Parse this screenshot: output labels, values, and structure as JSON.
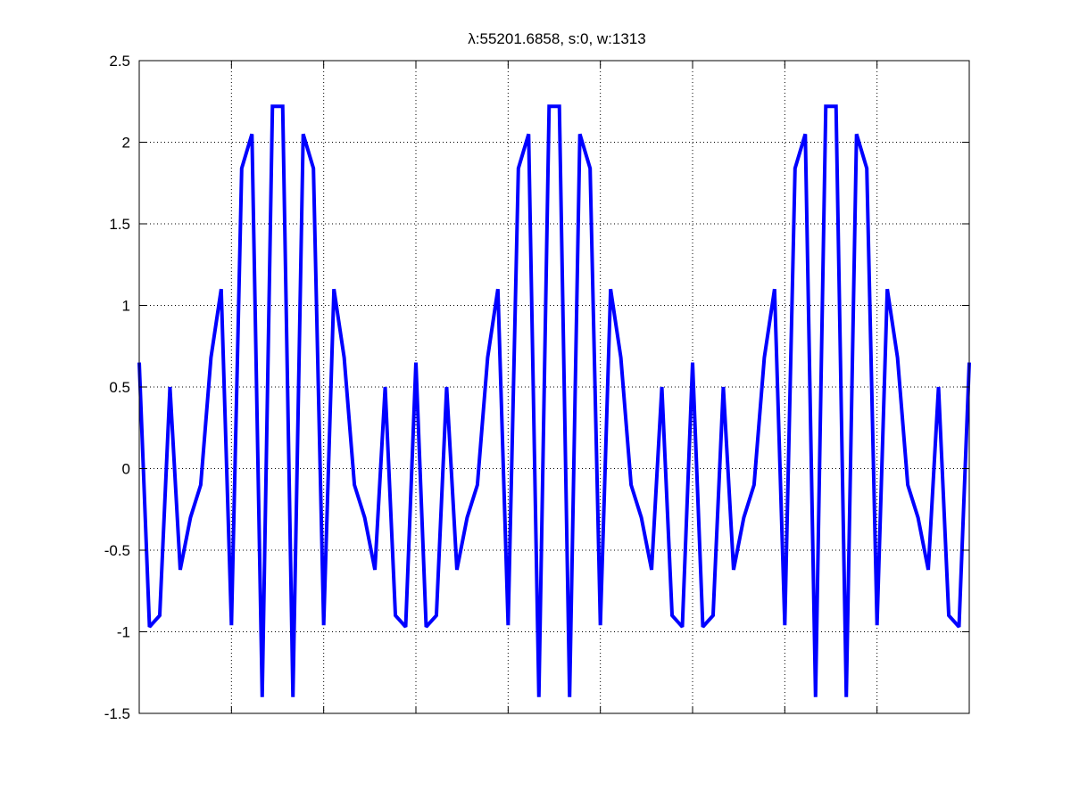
{
  "chart_data": {
    "type": "line",
    "title": "λ:55201.6858, s:0, w:1313",
    "xlabel": "",
    "ylabel": "",
    "ylim": [
      -1.5,
      2.5
    ],
    "xlim": [
      0,
      81
    ],
    "yticks": [
      -1.5,
      -1,
      -0.5,
      0,
      0.5,
      1,
      1.5,
      2,
      2.5
    ],
    "ytick_labels": [
      "-1.5",
      "-1",
      "-0.5",
      "0",
      "0.5",
      "1",
      "1.5",
      "2",
      "2.5"
    ],
    "xticks": [
      9,
      18,
      27,
      36,
      45,
      54,
      63,
      72
    ],
    "xtick_labels": [],
    "grid": true,
    "line_color": "#0000ff",
    "series": [
      {
        "x": [
          0,
          1,
          2,
          3,
          4,
          5,
          6,
          7,
          8,
          9,
          10,
          11,
          12,
          13,
          14,
          15,
          16,
          17,
          18,
          19,
          20,
          21,
          22,
          23,
          24,
          25,
          26,
          27,
          28,
          29,
          30,
          31,
          32,
          33,
          34,
          35,
          36,
          37,
          38,
          39,
          40,
          41,
          42,
          43,
          44,
          45,
          46,
          47,
          48,
          49,
          50,
          51,
          52,
          53,
          54,
          55,
          56,
          57,
          58,
          59,
          60,
          61,
          62,
          63,
          64,
          65,
          66,
          67,
          68,
          69,
          70,
          71,
          72,
          73,
          74,
          75,
          76,
          77,
          78,
          79,
          80,
          81
        ],
        "values": [
          0.65,
          -0.97,
          -0.9,
          0.5,
          -0.62,
          -0.3,
          -0.1,
          0.68,
          1.1,
          -0.96,
          1.84,
          2.05,
          -1.4,
          2.22,
          2.22,
          -1.4,
          2.05,
          1.84,
          -0.96,
          1.1,
          0.68,
          -0.1,
          -0.3,
          -0.62,
          0.5,
          -0.9,
          -0.97,
          0.65,
          -0.97,
          -0.9,
          0.5,
          -0.62,
          -0.3,
          -0.1,
          0.68,
          1.1,
          -0.96,
          1.84,
          2.05,
          -1.4,
          2.22,
          2.22,
          -1.4,
          2.05,
          1.84,
          -0.96,
          1.1,
          0.68,
          -0.1,
          -0.3,
          -0.62,
          0.5,
          -0.9,
          -0.97,
          0.65,
          -0.97,
          -0.9,
          0.5,
          -0.62,
          -0.3,
          -0.1,
          0.68,
          1.1,
          -0.96,
          1.84,
          2.05,
          -1.4,
          2.22,
          2.22,
          -1.4,
          2.05,
          1.84,
          -0.96,
          1.1,
          0.68,
          -0.1,
          -0.3,
          -0.62,
          0.5,
          -0.9,
          -0.97,
          0.65
        ]
      }
    ]
  }
}
